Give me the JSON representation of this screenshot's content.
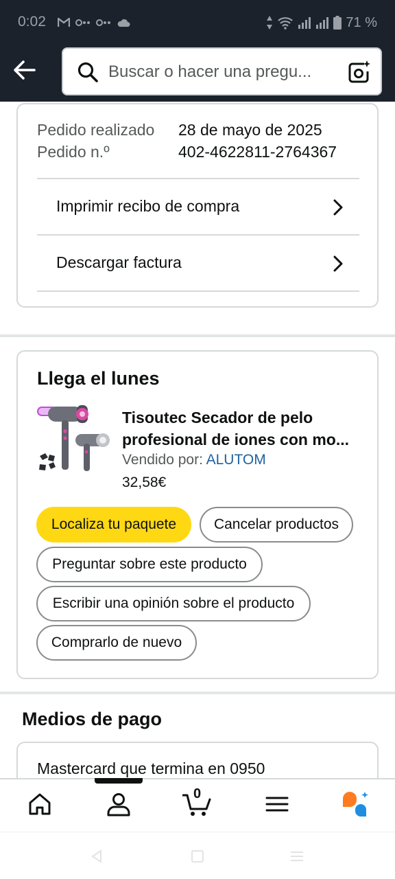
{
  "status_bar": {
    "time": "0:02",
    "battery": "71 %"
  },
  "search": {
    "placeholder": "Buscar o hacer una pregu..."
  },
  "order_info": {
    "rows": [
      {
        "label": "Pedido realizado",
        "value": "28 de mayo de 2025"
      },
      {
        "label": "Pedido n.º",
        "value": "402-4622811-2764367"
      }
    ],
    "links": [
      {
        "label": "Imprimir recibo de compra"
      },
      {
        "label": "Descargar factura"
      }
    ]
  },
  "delivery": {
    "title": "Llega el lunes",
    "product": {
      "title": "Tisoutec Secador de pelo profesional de iones con mo...",
      "seller_prefix": "Vendido por:",
      "seller_name": "ALUTOM",
      "price": "32,58€"
    },
    "actions": {
      "track": "Localiza tu paquete",
      "cancel": "Cancelar productos",
      "ask": "Preguntar sobre este producto",
      "review": "Escribir una opinión sobre el producto",
      "buy_again": "Comprarlo de nuevo"
    }
  },
  "payment": {
    "title": "Medios de pago",
    "method": "Mastercard  que termina en 0950"
  },
  "bottom_nav": {
    "cart_count": "0",
    "items": [
      "home-icon",
      "profile-icon",
      "cart-icon",
      "menu-icon",
      "rufus-icon"
    ]
  },
  "colors": {
    "header_bg": "#1b222b",
    "primary_button": "#ffd814",
    "link": "#2162a1",
    "border": "#d5d9d9"
  }
}
